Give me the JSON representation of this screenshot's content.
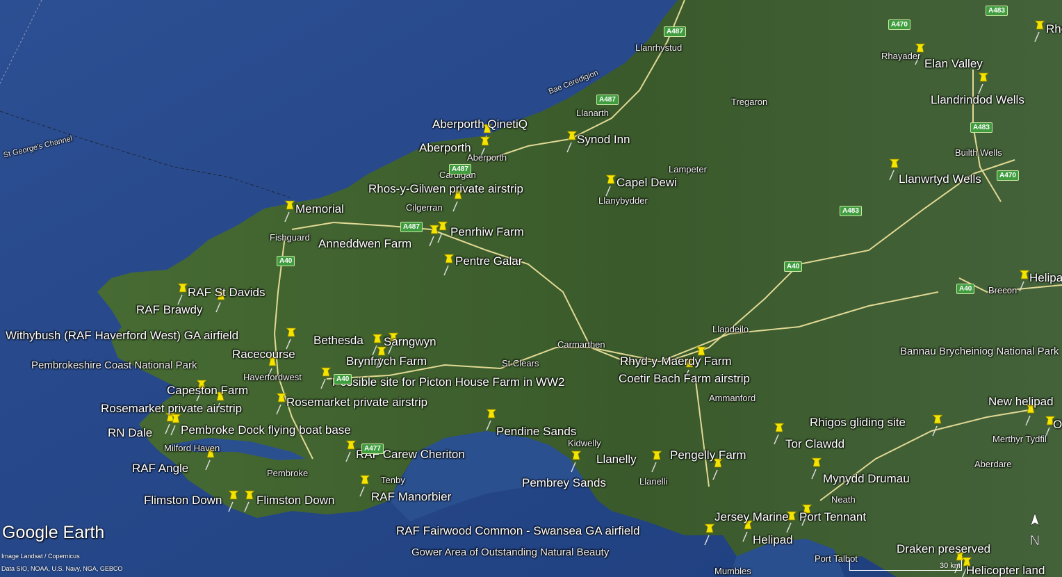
{
  "app": {
    "logo": "Google Earth",
    "credit_line1": "Image Landsat / Copernicus",
    "credit_line2": "Data SIO, NOAA, U.S. Navy, NGA, GEBCO",
    "scale_label": "30 km",
    "compass_letter": "N"
  },
  "colors": {
    "sea": "#2b4f8f",
    "land": "#3c5a2e",
    "pin": "#f5e400",
    "road": "#f3e7a0",
    "road_shield": "#3f9d3f"
  },
  "placemarks": [
    {
      "name": "Aberporth QinetiQ"
    },
    {
      "name": "Aberporth"
    },
    {
      "name": "Synod Inn"
    },
    {
      "name": "Rhos-y-Gilwen private airstrip"
    },
    {
      "name": "Capel Dewi"
    },
    {
      "name": "Memorial"
    },
    {
      "name": "Penrhiw Farm"
    },
    {
      "name": "Anneddwen Farm"
    },
    {
      "name": "Pentre Galar"
    },
    {
      "name": "RAF St Davids"
    },
    {
      "name": "RAF Brawdy"
    },
    {
      "name": "Withybush (RAF Haverford West) GA airfield"
    },
    {
      "name": "Bethesda"
    },
    {
      "name": "Sarngwyn"
    },
    {
      "name": "Racecourse"
    },
    {
      "name": "Brynfrych Farm"
    },
    {
      "name": "Possible site for Picton House Farm in WW2"
    },
    {
      "name": "Capeston Farm"
    },
    {
      "name": "Rosemarket private airstrip"
    },
    {
      "name": "Rosemarket private airstrip"
    },
    {
      "name": "RN Dale"
    },
    {
      "name": "Pembroke Dock flying boat base"
    },
    {
      "name": "RAF Angle"
    },
    {
      "name": "RAF Carew Cheriton"
    },
    {
      "name": "Pendine Sands"
    },
    {
      "name": "Flimston Down"
    },
    {
      "name": "Flimston Down"
    },
    {
      "name": "RAF Manorbier"
    },
    {
      "name": "Pembrey Sands"
    },
    {
      "name": "Llanelly"
    },
    {
      "name": "Pengelly Farm"
    },
    {
      "name": "Rhyd-y-Maerdy Farm"
    },
    {
      "name": "Coetir Bach Farm airstrip"
    },
    {
      "name": "Tor Clawdd"
    },
    {
      "name": "Mynydd Drumau"
    },
    {
      "name": "Rhigos gliding site"
    },
    {
      "name": "RAF Fairwood Common - Swansea GA airfield"
    },
    {
      "name": "Jersey Marine"
    },
    {
      "name": "Port Tennant"
    },
    {
      "name": "Helipad"
    },
    {
      "name": "Elan Valley"
    },
    {
      "name": "Llandrindod Wells"
    },
    {
      "name": "Llanwrtyd Wells"
    },
    {
      "name": "Helipad"
    },
    {
      "name": "New helipad"
    },
    {
      "name": "Old"
    },
    {
      "name": "Draken preserved"
    },
    {
      "name": "Helicopter land"
    },
    {
      "name": "Rho"
    }
  ],
  "towns": [
    "Llanrhystud",
    "Tregaron",
    "Llanarth",
    "Aberporth",
    "Cardigan",
    "Cilgerran",
    "Lampeter",
    "Llanybydder",
    "Fishguard",
    "Llandeilo",
    "Carmarthen",
    "St Clears",
    "Haverfordwest",
    "Ammanford",
    "Kidwelly",
    "Llanelli",
    "Milford Haven",
    "Pembroke",
    "Tenby",
    "Neath",
    "Port Talbot",
    "Mumbles",
    "Aberdare",
    "Merthyr Tydfil",
    "Rhayader",
    "Builth Wells",
    "Brecon"
  ],
  "areas": [
    "Pembrokeshire Coast National Park",
    "Gower Area of Outstanding Natural Beauty",
    "Bannau Brycheiniog National Park"
  ],
  "sea_labels": [
    "St George's Channel",
    "Bae Ceredigion"
  ],
  "road_shields": [
    "A487",
    "A487",
    "A487",
    "A487",
    "A40",
    "A40",
    "A40",
    "A40",
    "A483",
    "A483",
    "A483",
    "A470",
    "A470",
    "A477"
  ]
}
